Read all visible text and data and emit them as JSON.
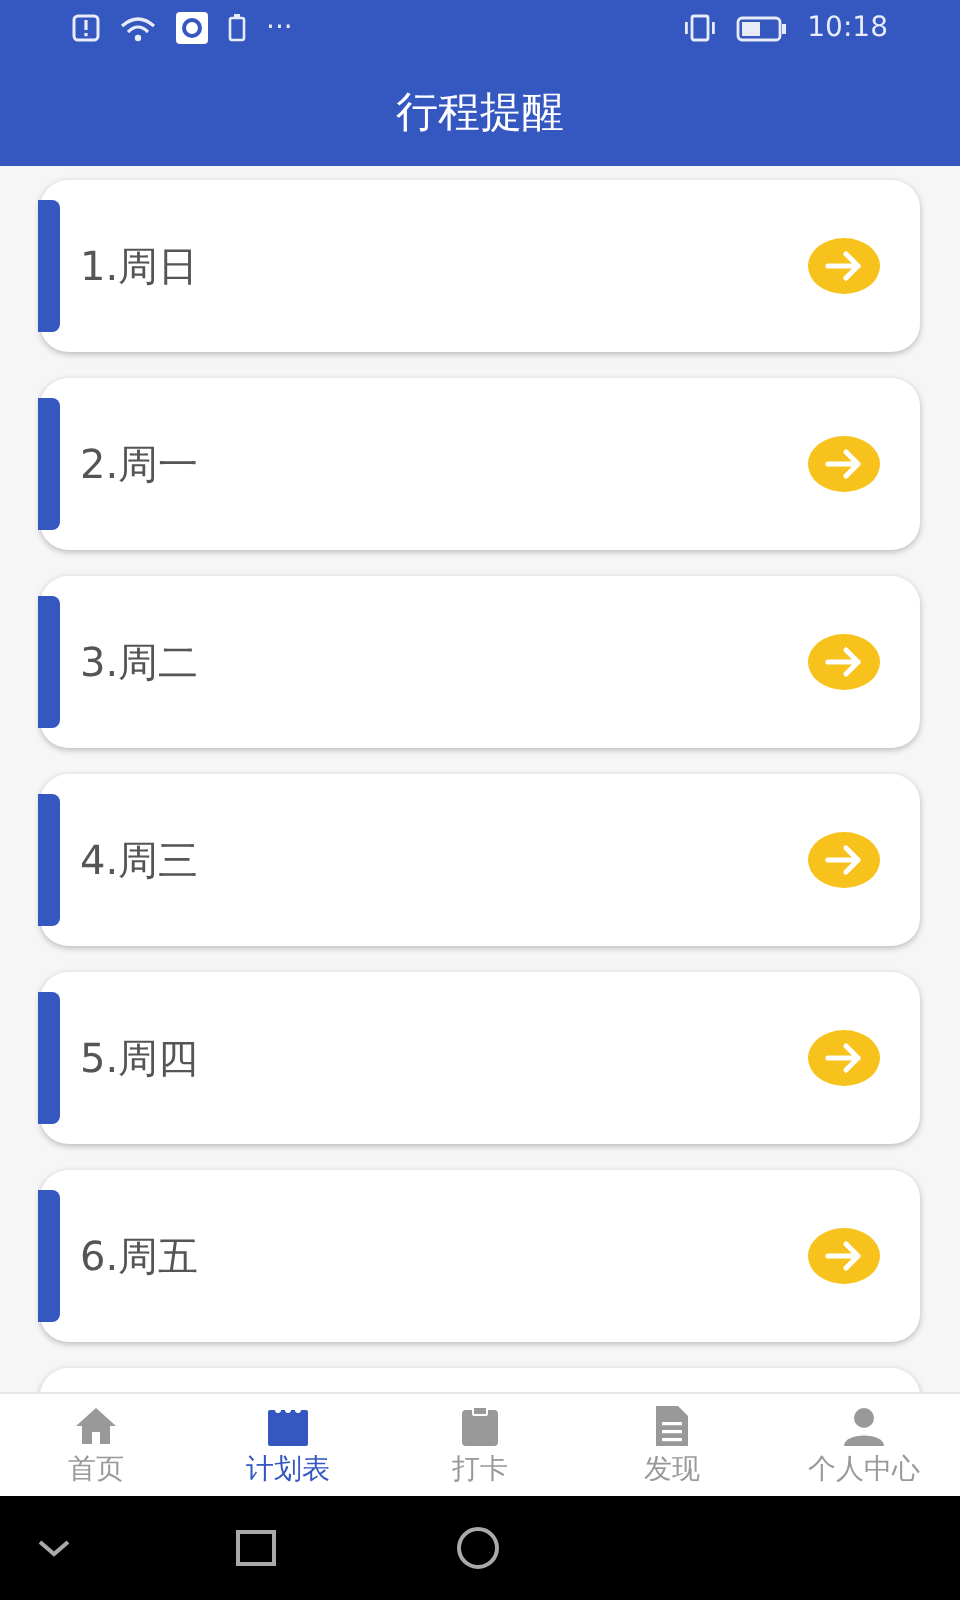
{
  "status_bar": {
    "time": "10:18",
    "more": "···"
  },
  "header": {
    "title": "行程提醒"
  },
  "items": [
    {
      "label": "1.周日"
    },
    {
      "label": "2.周一"
    },
    {
      "label": "3.周二"
    },
    {
      "label": "4.周三"
    },
    {
      "label": "5.周四"
    },
    {
      "label": "6.周五"
    }
  ],
  "more_below": true,
  "tabs": [
    {
      "label": "首页",
      "selected": false
    },
    {
      "label": "计划表",
      "selected": true
    },
    {
      "label": "打卡",
      "selected": false
    },
    {
      "label": "发现",
      "selected": false
    },
    {
      "label": "个人中心",
      "selected": false
    }
  ]
}
